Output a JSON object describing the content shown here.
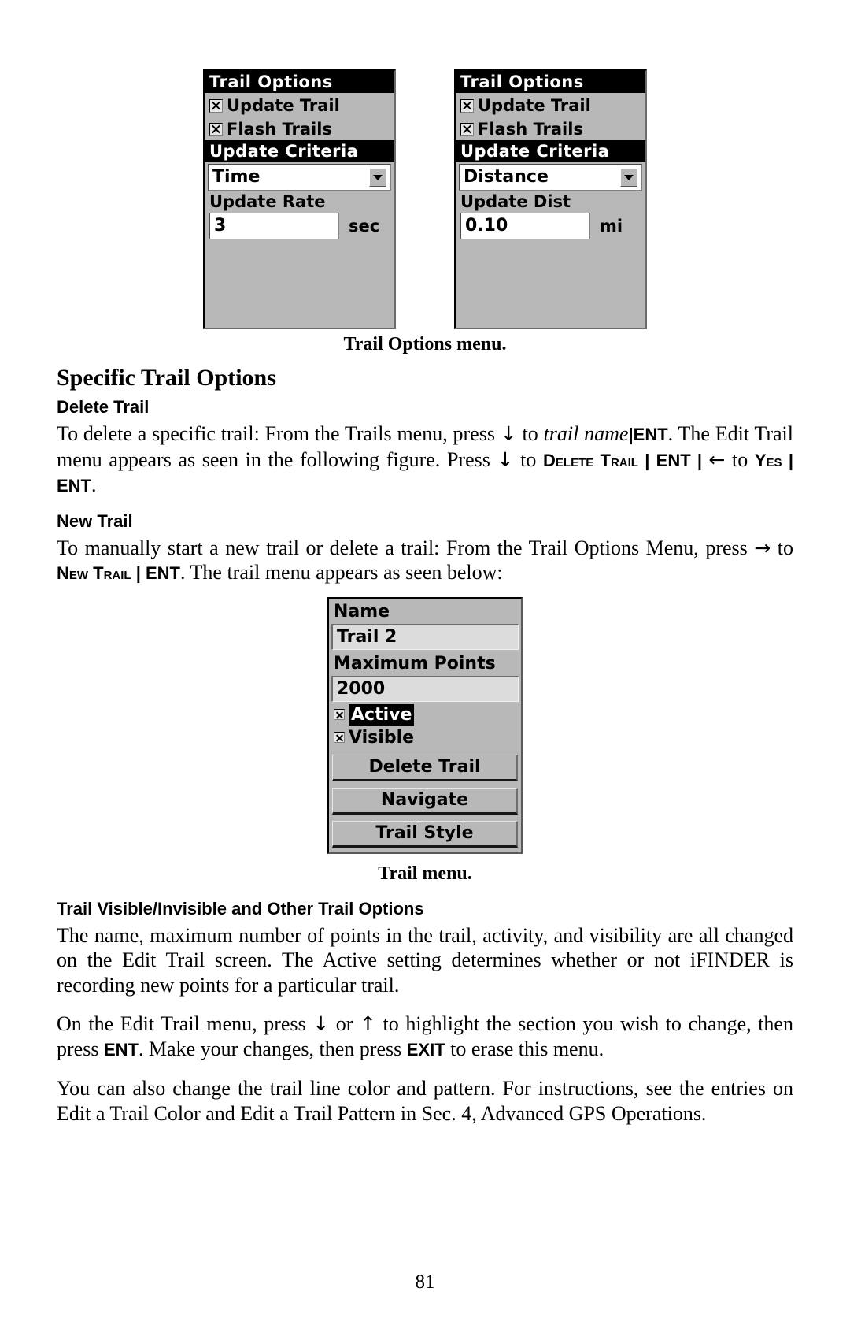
{
  "figure_top": {
    "caption": "Trail Options menu.",
    "screens": [
      {
        "title": "Trail Options",
        "check_update_trail": "Update Trail",
        "check_flash_trails": "Flash Trails",
        "criteria_header": "Update Criteria",
        "criteria_value": "Time",
        "rate_label": "Update Rate",
        "rate_value": "3",
        "rate_unit": "sec"
      },
      {
        "title": "Trail Options",
        "check_update_trail": "Update Trail",
        "check_flash_trails": "Flash Trails",
        "criteria_header": "Update Criteria",
        "criteria_value": "Distance",
        "rate_label": "Update Dist",
        "rate_value": "0.10",
        "rate_unit": "mi"
      }
    ]
  },
  "section": {
    "title": "Specific Trail Options"
  },
  "delete_trail": {
    "heading": "Delete Trail",
    "p1_a": "To delete a specific trail: From the Trails menu, press ",
    "p1_arrow_down": "↓",
    "p1_b": " to ",
    "p1_italic": "trail name",
    "p1_sep1": "|",
    "p1_ent1": "ENT",
    "p1_c": ". The Edit Trail menu appears as seen in the following figure. Press ",
    "p1_arrow_down2": "↓",
    "p1_d": " to ",
    "p1_sc_delete": "Delete Trail",
    "p1_sep2": " | ",
    "p1_ent2": "ENT",
    "p1_sep3": " | ",
    "p1_arrow_left": "←",
    "p1_e": " to ",
    "p1_sc_yes": "Yes",
    "p1_sep4": " | ",
    "p1_ent3": "ENT",
    "p1_f": "."
  },
  "new_trail": {
    "heading": "New Trail",
    "p1_a": "To manually start a new trail or delete a trail: From the Trail Options Menu, press ",
    "p1_arrow_right": "→",
    "p1_b": " to ",
    "p1_sc_new": "New Trail",
    "p1_sep1": " | ",
    "p1_ent": "ENT",
    "p1_c": ". The trail menu appears as seen below:"
  },
  "figure_mid": {
    "caption": "Trail menu.",
    "name_label": "Name",
    "name_value": "Trail 2",
    "maxpoints_label": "Maximum Points",
    "maxpoints_value": "2000",
    "active_label": "Active",
    "visible_label": "Visible",
    "btn_delete": "Delete Trail",
    "btn_navigate": "Navigate",
    "btn_style": "Trail Style"
  },
  "visible_section": {
    "heading": "Trail Visible/Invisible and Other Trail Options",
    "p1": "The name, maximum number of points in the trail, activity, and visibility are all changed on the Edit Trail screen. The Active setting determines whether or not iFINDER is recording new points for a particular trail.",
    "p2_a": "On the Edit Trail menu, press ",
    "p2_arrow_down": "↓",
    "p2_b": " or ",
    "p2_arrow_up": "↑",
    "p2_c": " to highlight the section you wish to change, then press ",
    "p2_ent": "ENT",
    "p2_d": ". Make your changes, then press ",
    "p2_exit": "EXIT",
    "p2_e": " to erase this menu.",
    "p3": "You can also change the trail line color and pattern. For instructions, see the entries on Edit a Trail Color and Edit a Trail Pattern in Sec. 4, Advanced GPS Operations."
  },
  "footer": {
    "page_number": "81"
  }
}
